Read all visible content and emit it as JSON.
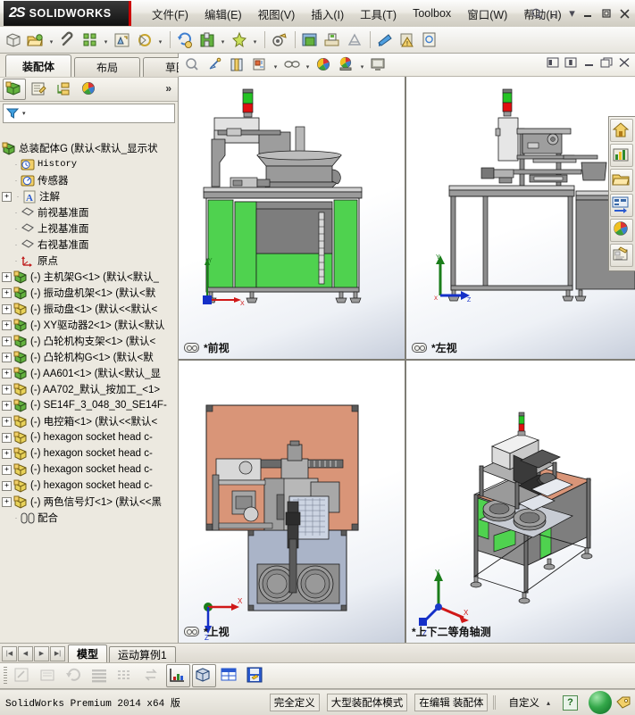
{
  "window": {
    "brand_ds": "2S",
    "brand_name": "SOLIDWORKS",
    "menu": [
      {
        "label": "文件(F)",
        "name": "menu-file"
      },
      {
        "label": "编辑(E)",
        "name": "menu-edit"
      },
      {
        "label": "视图(V)",
        "name": "menu-view"
      },
      {
        "label": "插入(I)",
        "name": "menu-insert"
      },
      {
        "label": "工具(T)",
        "name": "menu-tools"
      },
      {
        "label": "Toolbox",
        "name": "menu-toolbox"
      },
      {
        "label": "窗口(W)",
        "name": "menu-window"
      },
      {
        "label": "帮助(H)",
        "name": "menu-help"
      }
    ],
    "controls": {
      "minimize": "—",
      "restore": "❐",
      "close": "✕",
      "help_caret": "▾"
    }
  },
  "left_panel": {
    "tabs": [
      {
        "label": "装配体",
        "active": true
      },
      {
        "label": "布局",
        "active": false
      },
      {
        "label": "草图",
        "active": false
      }
    ],
    "manager_tabs": [
      "feature-tree-icon",
      "property-manager-icon",
      "configuration-manager-icon",
      "display-manager-icon"
    ],
    "overflow": "»",
    "filter_placeholder": ""
  },
  "tree": {
    "root": "总装配体G   (默认<默认_显示状",
    "items": [
      {
        "label": "History",
        "icon": "history-icon",
        "expand": "none",
        "indent": 1,
        "mono": true
      },
      {
        "label": "传感器",
        "icon": "sensor-icon",
        "expand": "none",
        "indent": 1,
        "mono": false
      },
      {
        "label": "注解",
        "icon": "annotation-icon",
        "expand": "plus",
        "indent": 1,
        "mono": false
      },
      {
        "label": "前视基准面",
        "icon": "plane-icon",
        "expand": "none",
        "indent": 1,
        "mono": false
      },
      {
        "label": "上视基准面",
        "icon": "plane-icon",
        "expand": "none",
        "indent": 1,
        "mono": false
      },
      {
        "label": "右视基准面",
        "icon": "plane-icon",
        "expand": "none",
        "indent": 1,
        "mono": false
      },
      {
        "label": "原点",
        "icon": "origin-icon",
        "expand": "none",
        "indent": 1,
        "mono": false
      },
      {
        "label": "(-) 主机架G<1>  (默认<默认_",
        "icon": "part-green-icon",
        "expand": "plus",
        "indent": 0,
        "mono": false
      },
      {
        "label": "(-) 振动盘机架<1>  (默认<默",
        "icon": "part-green-icon",
        "expand": "plus",
        "indent": 0,
        "mono": false
      },
      {
        "label": "(-) 振动盘<1>  (默认<<默认<",
        "icon": "part-yellow-icon",
        "expand": "plus",
        "indent": 0,
        "mono": false
      },
      {
        "label": "(-) XY驱动器2<1>  (默认<默认",
        "icon": "part-green-icon",
        "expand": "plus",
        "indent": 0,
        "mono": false
      },
      {
        "label": "(-) 凸轮机构支架<1>  (默认<",
        "icon": "part-green-icon",
        "expand": "plus",
        "indent": 0,
        "mono": false
      },
      {
        "label": "(-) 凸轮机构G<1>  (默认<默",
        "icon": "part-green-icon",
        "expand": "plus",
        "indent": 0,
        "mono": false
      },
      {
        "label": "(-) AA601<1>  (默认<默认_显",
        "icon": "part-green-icon",
        "expand": "plus",
        "indent": 0,
        "mono": false
      },
      {
        "label": "(-) AA702_默认_按加工_<1>",
        "icon": "part-yellow-icon",
        "expand": "plus",
        "indent": 0,
        "mono": false
      },
      {
        "label": "(-) SE14F_3_048_30_SE14F-",
        "icon": "part-green-icon",
        "expand": "plus",
        "indent": 0,
        "mono": false
      },
      {
        "label": "(-) 电控箱<1>  (默认<<默认<",
        "icon": "part-yellow-icon",
        "expand": "plus",
        "indent": 0,
        "mono": false
      },
      {
        "label": "(-) hexagon socket head c-",
        "icon": "part-yellow-icon",
        "expand": "plus",
        "indent": 0,
        "mono": false
      },
      {
        "label": "(-) hexagon socket head c-",
        "icon": "part-yellow-icon",
        "expand": "plus",
        "indent": 0,
        "mono": false
      },
      {
        "label": "(-) hexagon socket head c-",
        "icon": "part-yellow-icon",
        "expand": "plus",
        "indent": 0,
        "mono": false
      },
      {
        "label": "(-) hexagon socket head c-",
        "icon": "part-yellow-icon",
        "expand": "plus",
        "indent": 0,
        "mono": false
      },
      {
        "label": "(-) 两色信号灯<1>  (默认<<黑",
        "icon": "part-yellow-icon",
        "expand": "plus",
        "indent": 0,
        "mono": false
      },
      {
        "label": "配合",
        "icon": "mates-icon",
        "expand": "none",
        "indent": 1,
        "mono": false
      }
    ]
  },
  "viewport_toolbar": {
    "buttons": [
      "zoom-to-area-icon",
      "section-view-icon",
      "view-orientation-icon",
      "display-style-icon",
      "hide-show-items-icon",
      "edit-appearance-icon",
      "apply-scene-icon",
      "view-settings-icon"
    ],
    "window_controls": [
      "restore-left-icon",
      "restore-right-icon",
      "minimize-icon",
      "restore-icon",
      "close-icon"
    ]
  },
  "views": [
    {
      "name": "view-front",
      "label": "*前视",
      "locked": true
    },
    {
      "name": "view-left",
      "label": "*左视",
      "locked": true
    },
    {
      "name": "view-top",
      "label": "*上视",
      "locked": true
    },
    {
      "name": "view-trimetric",
      "label": "*上下二等角轴测",
      "locked": false
    }
  ],
  "dock_toolbar": [
    "home-icon",
    "view-palette-icon",
    "open-folder-icon",
    "appearances-icon",
    "scenes-icon",
    "decals-icon"
  ],
  "doc_tabs": {
    "nav": [
      "first-icon",
      "prev-icon",
      "next-icon",
      "last-icon"
    ],
    "tabs": [
      {
        "label": "模型",
        "active": true
      },
      {
        "label": "运动算例1",
        "active": false
      }
    ]
  },
  "bottom_toolbar": {
    "buttons": [
      {
        "name": "edit-part-icon",
        "disabled": true,
        "selected": false
      },
      {
        "name": "edit-assembly-icon",
        "disabled": true,
        "selected": false
      },
      {
        "name": "rebuild-icon",
        "disabled": true,
        "selected": false
      },
      {
        "name": "list-icon",
        "disabled": true,
        "selected": false
      },
      {
        "name": "grid-icon",
        "disabled": true,
        "selected": false
      },
      {
        "name": "swap-icon",
        "disabled": true,
        "selected": false
      },
      {
        "name": "chart-icon",
        "disabled": false,
        "selected": true
      },
      {
        "name": "isometric-icon",
        "disabled": false,
        "selected": true
      },
      {
        "name": "table-icon",
        "disabled": false,
        "selected": false
      },
      {
        "name": "save-report-icon",
        "disabled": false,
        "selected": false
      }
    ]
  },
  "status_bar": {
    "product": "SolidWorks Premium 2014 x64 版",
    "cells": [
      "完全定义",
      "大型装配体模式",
      "在编辑  装配体"
    ],
    "custom_label": "自定义",
    "custom_caret": "▴",
    "help_glyph": "?"
  },
  "colors": {
    "accent_red": "#cc0000",
    "green_part": "#63b23e",
    "yellow_part": "#e8d25a",
    "salmon_table": "#d99578",
    "blue_gray": "#aab4c8",
    "gray_body": "#8c8c8c",
    "titlebar": "#ebe9e2",
    "panel_bg": "#ece9e0"
  }
}
